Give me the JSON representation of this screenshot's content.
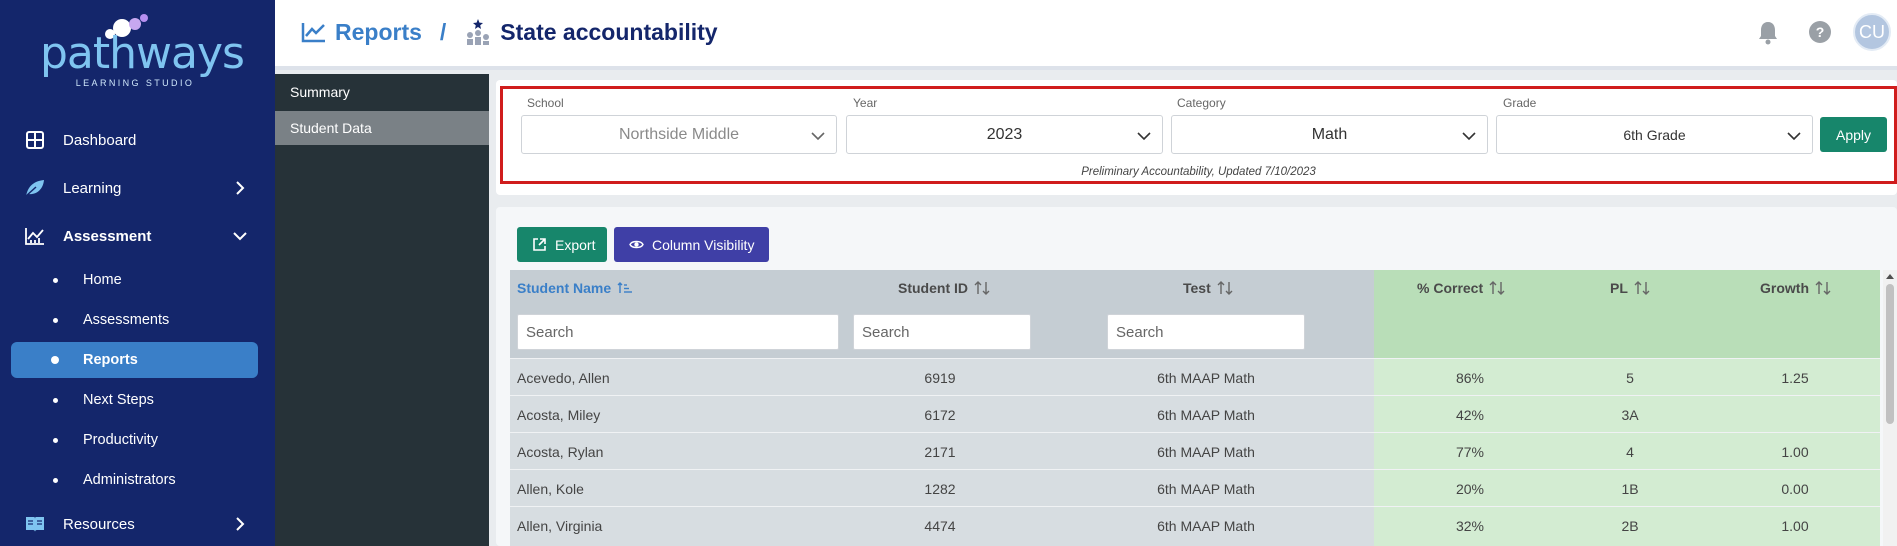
{
  "brand": {
    "name": "pathways",
    "tagline": "LEARNING STUDIO"
  },
  "nav": {
    "dashboard": "Dashboard",
    "learning": "Learning",
    "assessment": "Assessment",
    "sub": [
      "Home",
      "Assessments",
      "Reports",
      "Next Steps",
      "Productivity",
      "Administrators"
    ],
    "active_sub": "Reports",
    "resources": "Resources"
  },
  "header": {
    "section": "Reports",
    "separator": "/",
    "title": "State accountability",
    "avatar_initials": "CU"
  },
  "submenu": {
    "items": [
      "Summary",
      "Student Data"
    ],
    "active": "Student Data"
  },
  "filters": {
    "school": {
      "label": "School",
      "value": "Northside Middle"
    },
    "year": {
      "label": "Year",
      "value": "2023"
    },
    "category": {
      "label": "Category",
      "value": "Math"
    },
    "grade": {
      "label": "Grade",
      "value": "6th Grade"
    },
    "apply_label": "Apply",
    "note": "Preliminary Accountability, Updated 7/10/2023"
  },
  "toolbar": {
    "export_label": "Export",
    "column_visibility_label": "Column Visibility"
  },
  "table": {
    "columns": [
      "Student Name",
      "Student ID",
      "Test",
      "% Correct",
      "PL",
      "Growth"
    ],
    "search_placeholder": "Search",
    "rows": [
      [
        "Acevedo, Allen",
        "6919",
        "6th MAAP Math",
        "86%",
        "5",
        "1.25"
      ],
      [
        "Acosta, Miley",
        "6172",
        "6th MAAP Math",
        "42%",
        "3A",
        ""
      ],
      [
        "Acosta, Rylan",
        "2171",
        "6th MAAP Math",
        "77%",
        "4",
        "1.00"
      ],
      [
        "Allen, Kole",
        "1282",
        "6th MAAP Math",
        "20%",
        "1B",
        "0.00"
      ],
      [
        "Allen, Virginia",
        "4474",
        "6th MAAP Math",
        "32%",
        "2B",
        "1.00"
      ]
    ]
  },
  "colors": {
    "nav_bg": "#14266b",
    "accent_blue": "#3a7fc8",
    "green_button": "#17866b",
    "purple_button": "#3f3fa6",
    "grey_column": "#d7dde1",
    "green_column": "#d3ecd2",
    "highlight_outline": "#d01d1d"
  }
}
